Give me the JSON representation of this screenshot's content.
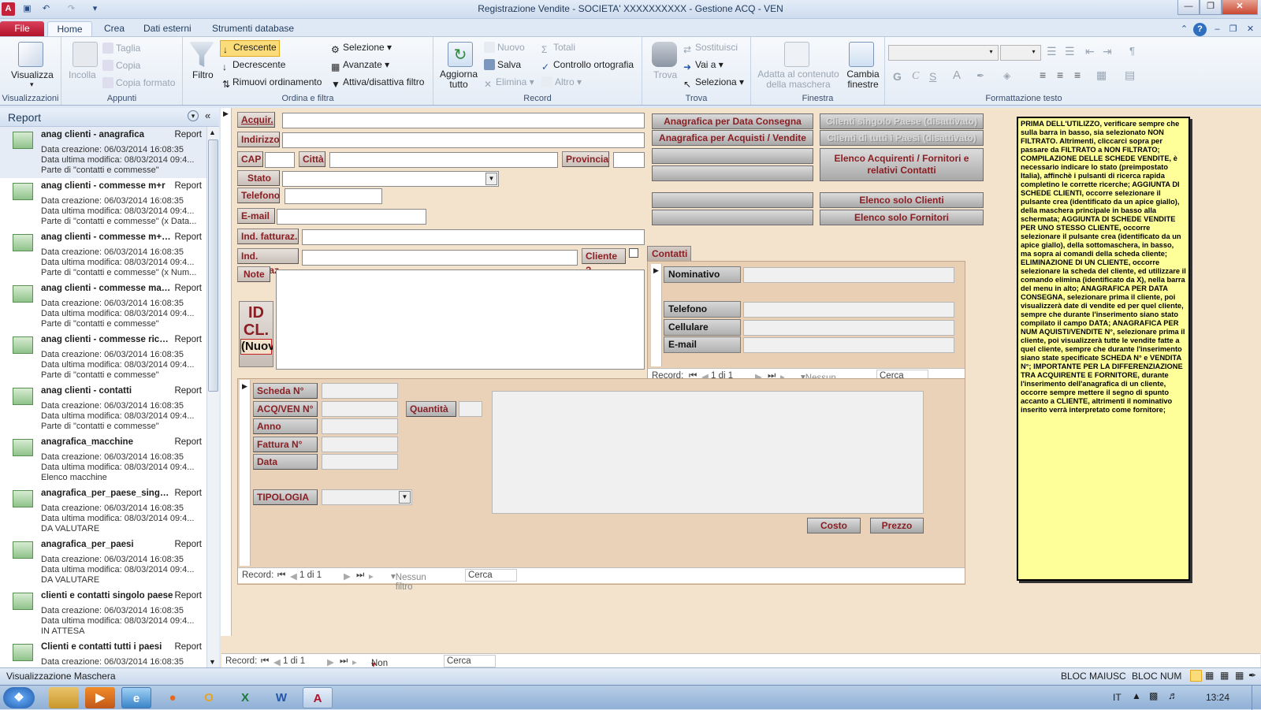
{
  "app_title": "Registrazione Vendite  -  SOCIETA' XXXXXXXXXX - Gestione ACQ - VEN",
  "tabs": [
    "File",
    "Home",
    "Crea",
    "Dati esterni",
    "Strumenti database"
  ],
  "ribbon": {
    "views": {
      "label": "Visualizzazioni",
      "visualizza": "Visualizza"
    },
    "clipboard": {
      "label": "Appunti",
      "incolla": "Incolla",
      "taglia": "Taglia",
      "copia": "Copia",
      "copia_formato": "Copia formato"
    },
    "sort": {
      "label": "Ordina e filtra",
      "filtro": "Filtro",
      "crescente": "Crescente",
      "decrescente": "Decrescente",
      "rimuovi": "Rimuovi ordinamento",
      "selezione": "Selezione",
      "avanzate": "Avanzate",
      "attiva": "Attiva/disattiva filtro"
    },
    "record": {
      "label": "Record",
      "aggiorna": "Aggiorna tutto",
      "nuovo": "Nuovo",
      "salva": "Salva",
      "elimina": "Elimina",
      "totali": "Totali",
      "controllo": "Controllo ortografia",
      "altro": "Altro"
    },
    "find": {
      "label": "Trova",
      "trova": "Trova",
      "sostituisci": "Sostituisci",
      "vai": "Vai a",
      "seleziona": "Seleziona"
    },
    "window": {
      "label": "Finestra",
      "adatta": "Adatta al contenuto della maschera",
      "cambia": "Cambia finestre"
    },
    "text": {
      "label": "Formattazione testo",
      "g": "G",
      "c": "C",
      "s": "S"
    }
  },
  "nav": {
    "title": "Report",
    "items": [
      {
        "name": "anag clienti - anagrafica",
        "type": "Report",
        "l1": "Data creazione: 06/03/2014 16:08:35",
        "l2": "Data ultima modifica: 08/03/2014 09:4...",
        "l3": "Parte di \"contatti e commesse\""
      },
      {
        "name": "anag clienti - commesse m+r",
        "type": "Report",
        "l1": "Data creazione: 06/03/2014 16:08:35",
        "l2": "Data ultima modifica: 08/03/2014 09:4...",
        "l3": "Parte di \"contatti e commesse\" (x Data..."
      },
      {
        "name": "anag clienti - commesse m+r (...",
        "type": "Report",
        "l1": "Data creazione: 06/03/2014 16:08:35",
        "l2": "Data ultima modifica: 08/03/2014 09:4...",
        "l3": "Parte di \"contatti e commesse\" (x Num..."
      },
      {
        "name": "anag clienti - commesse macc...",
        "type": "Report",
        "l1": "Data creazione: 06/03/2014 16:08:35",
        "l2": "Data ultima modifica: 08/03/2014 09:4...",
        "l3": "Parte di \"contatti e commesse\""
      },
      {
        "name": "anag clienti - commesse ricambi",
        "type": "Report",
        "l1": "Data creazione: 06/03/2014 16:08:35",
        "l2": "Data ultima modifica: 08/03/2014 09:4...",
        "l3": "Parte di \"contatti e commesse\""
      },
      {
        "name": "anag clienti - contatti",
        "type": "Report",
        "l1": "Data creazione: 06/03/2014 16:08:35",
        "l2": "Data ultima modifica: 08/03/2014 09:4...",
        "l3": "Parte di \"contatti e commesse\""
      },
      {
        "name": "anagrafica_macchine",
        "type": "Report",
        "l1": "Data creazione: 06/03/2014 16:08:35",
        "l2": "Data ultima modifica: 08/03/2014 09:4...",
        "l3": "Elenco macchine"
      },
      {
        "name": "anagrafica_per_paese_singolo",
        "type": "Report",
        "l1": "Data creazione: 06/03/2014 16:08:35",
        "l2": "Data ultima modifica: 08/03/2014 09:4...",
        "l3": "DA VALUTARE"
      },
      {
        "name": "anagrafica_per_paesi",
        "type": "Report",
        "l1": "Data creazione: 06/03/2014 16:08:35",
        "l2": "Data ultima modifica: 08/03/2014 09:4...",
        "l3": "DA VALUTARE"
      },
      {
        "name": "clienti e contatti singolo paese",
        "type": "Report",
        "l1": "Data creazione: 06/03/2014 16:08:35",
        "l2": "Data ultima modifica: 08/03/2014 09:4...",
        "l3": "IN ATTESA"
      },
      {
        "name": "Clienti e contatti tutti i paesi",
        "type": "Report",
        "l1": "Data creazione: 06/03/2014 16:08:35",
        "l2": "",
        "l3": ""
      }
    ]
  },
  "form": {
    "labels": {
      "acquir": "Acquir.",
      "indirizzo": "Indirizzo",
      "cap": "CAP",
      "citta": "Città",
      "provincia": "Provincia",
      "stato": "Stato",
      "telefono": "Telefono",
      "email": "E-mail",
      "ind_fatt": "Ind. fatturaz.",
      "ind_dest": "Ind. destinaz.",
      "cliente": "Cliente ?",
      "note": "Note",
      "id": "ID CL.",
      "nuovo": "(Nuovo)"
    },
    "buttons": {
      "b1": "Anagrafica per Data Consegna",
      "b2": "Anagrafica per Acquisti / Vendite N°",
      "b3": "Clienti singolo Paese (disattivato)",
      "b4": "Clienti di tutti i Paesi (disattivato)",
      "b5": "Elenco Acquirenti / Fornitori e relativi Contatti",
      "b6": "Elenco solo Clienti",
      "b7": "Elenco solo Fornitori"
    },
    "contacts": {
      "tab": "Contatti",
      "nominativo": "Nominativo",
      "telefono": "Telefono",
      "cellulare": "Cellulare",
      "email": "E-mail",
      "nav": {
        "record": "Record:",
        "pos": "1 di 1",
        "filter": "Nessun filtro",
        "search": "Cerca"
      }
    },
    "sales": {
      "scheda": "Scheda N°",
      "acqven": "ACQ/VEN N°",
      "anno": "Anno",
      "fattura": "Fattura N°",
      "data": "Data",
      "quantita": "Quantità",
      "tipologia": "TIPOLOGIA",
      "costo": "Costo",
      "prezzo": "Prezzo",
      "nav": {
        "record": "Record:",
        "pos": "1 di 1",
        "filter": "Nessun filtro",
        "search": "Cerca"
      }
    },
    "main_nav": {
      "record": "Record:",
      "pos": "1 di 1",
      "filter": "Non filtrato",
      "search": "Cerca"
    }
  },
  "note": "PRIMA DELL'UTILIZZO, verificare sempre che sulla barra in basso, sia selezionato NON FILTRATO. Altrimenti, cliccarci sopra per passare da FILTRATO  a NON FILTRATO; COMPILAZIONE DELLE SCHEDE VENDITE, è necessario indicare lo stato (preimpostato Italia), affinchè i pulsanti di ricerca rapida completino le corrette ricerche; AGGIUNTA DI SCHEDE CLIENTI, occorre selezionare il pulsante crea (identificato da un apice giallo), della maschera principale in basso alla schermata; AGGIUNTA DI SCHEDE VENDITE PER UNO STESSO CLIENTE, occorre selezionare il pulsante crea (identificato da un apice giallo), della sottomaschera, in basso, ma sopra ai comandi della scheda cliente; ELIMINAZIONE DI UN CLIENTE, occorre selezionare la scheda del cliente, ed utilizzare il comando elimina (identificato da X), nella barra del menu in alto; ANAGRAFICA PER DATA CONSEGNA, selezionare prima il cliente, poi visualizzerà date di vendite ed per quel cliente, sempre che durante l'inserimento siano stato compilato il campo DATA; ANAGRAFICA PER NUM AQUISTI/VENDITE N°, selezionare prima il cliente, poi visualizzerà tutte le vendite fatte a quel cliente, sempre che durante l'inserimento siano state specificate SCHEDA N° e VENDITA N°; IMPORTANTE PER LA DIFFERENZIAZIONE TRA ACQUIRENTE E FORNITORE, durante l'inserimento dell'anagrafica di un cliente, occorre sempre mettere il segno di spunto accanto a CLIENTE, altrimenti il nominativo inserito verrà interpretato come fornitore;",
  "status": {
    "left": "Visualizzazione Maschera",
    "caps": "BLOC MAIUSC",
    "num": "BLOC NUM"
  },
  "taskbar": {
    "lang": "IT",
    "time": "13:24"
  }
}
